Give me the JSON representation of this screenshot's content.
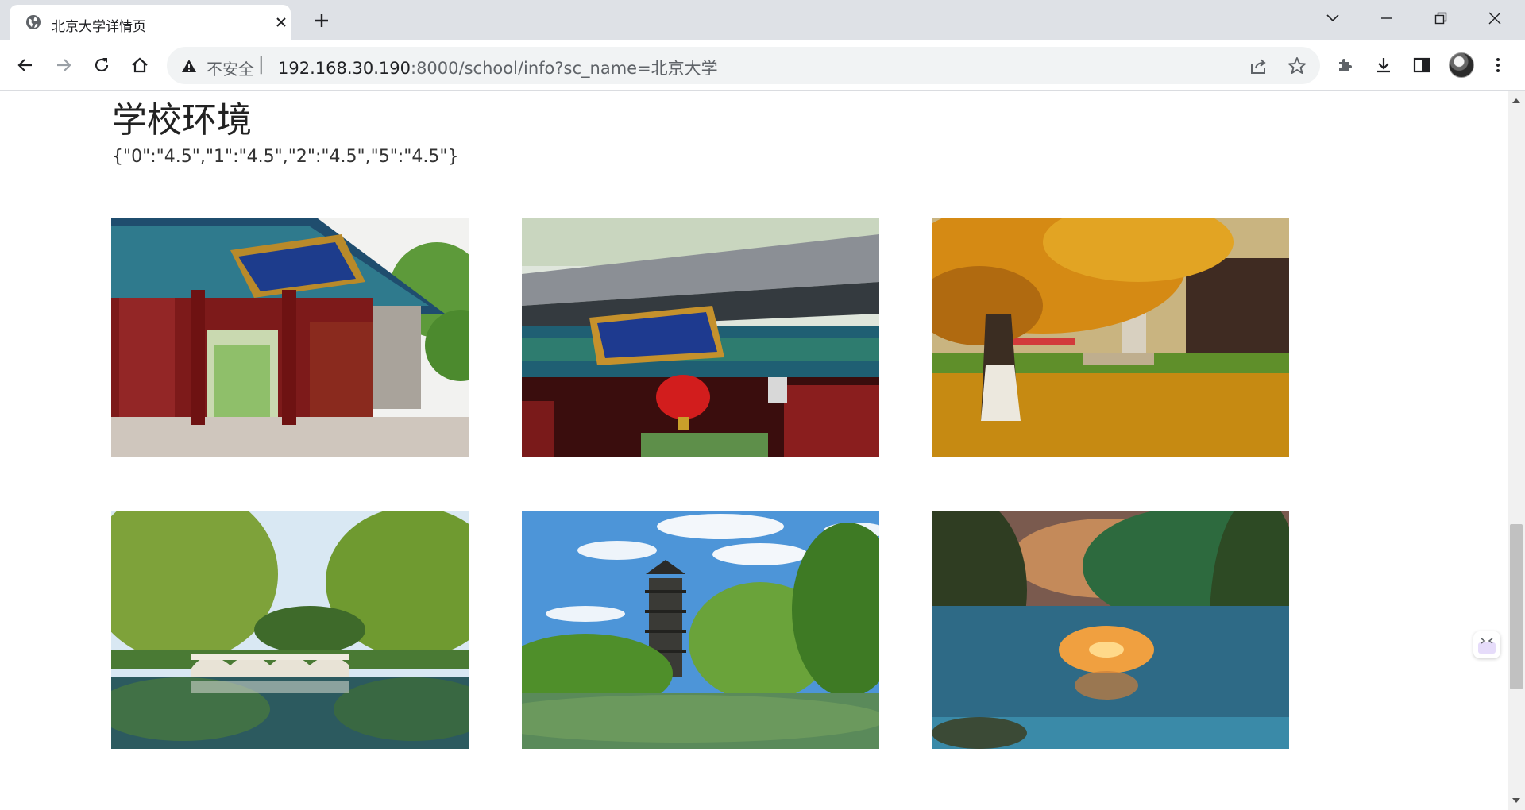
{
  "browser": {
    "tab_title": "北京大学详情页",
    "security_label": "不安全",
    "url_host": "192.168.30.190",
    "url_rest": ":8000/school/info?sc_name=北京大学"
  },
  "page": {
    "section_title": "学校环境",
    "ratings_text": "{\"0\":\"4.5\",\"1\":\"4.5\",\"2\":\"4.5\",\"5\":\"4.5\"}",
    "photos": [
      {
        "name": "west-gate-photo"
      },
      {
        "name": "gate-plaque-lantern-photo"
      },
      {
        "name": "autumn-ginkgo-photo"
      },
      {
        "name": "willow-bridge-lake-photo"
      },
      {
        "name": "boya-pagoda-photo"
      },
      {
        "name": "sunset-lake-photo"
      }
    ]
  },
  "colors": {
    "chrome_bg": "#dee1e6",
    "omnibox_bg": "#f1f3f4",
    "icon": "#5f6368"
  }
}
